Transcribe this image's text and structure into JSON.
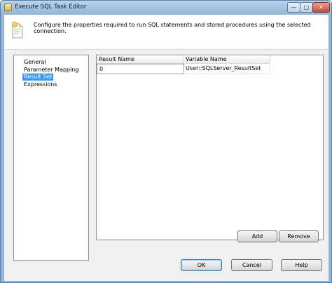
{
  "window": {
    "title": "Execute SQL Task Editor"
  },
  "header": {
    "description": "Configure the properties required to run SQL statements and stored procedures using the selected connection."
  },
  "nav": {
    "items": [
      {
        "label": "General"
      },
      {
        "label": "Parameter Mapping"
      },
      {
        "label": "Result Set"
      },
      {
        "label": "Expressions"
      }
    ],
    "selected": "Result Set"
  },
  "result_grid": {
    "columns": [
      "Result Name",
      "Variable Name"
    ],
    "rows": [
      {
        "result_name": "0",
        "variable_name": "User::SQLServer_ResultSet"
      }
    ]
  },
  "buttons": {
    "add": "Add",
    "remove": "Remove",
    "ok": "OK",
    "cancel": "Cancel",
    "help": "Help"
  },
  "colors": {
    "selection": "#3399ff",
    "titlebar": "#8fb5d8",
    "close_button": "#c44a30",
    "dialog_background": "#f0f0f0"
  },
  "icons": {
    "title": "task-editor-icon",
    "header": "script-document-icon",
    "minimize": "minimize-icon",
    "maximize": "maximize-icon",
    "close": "close-icon"
  }
}
